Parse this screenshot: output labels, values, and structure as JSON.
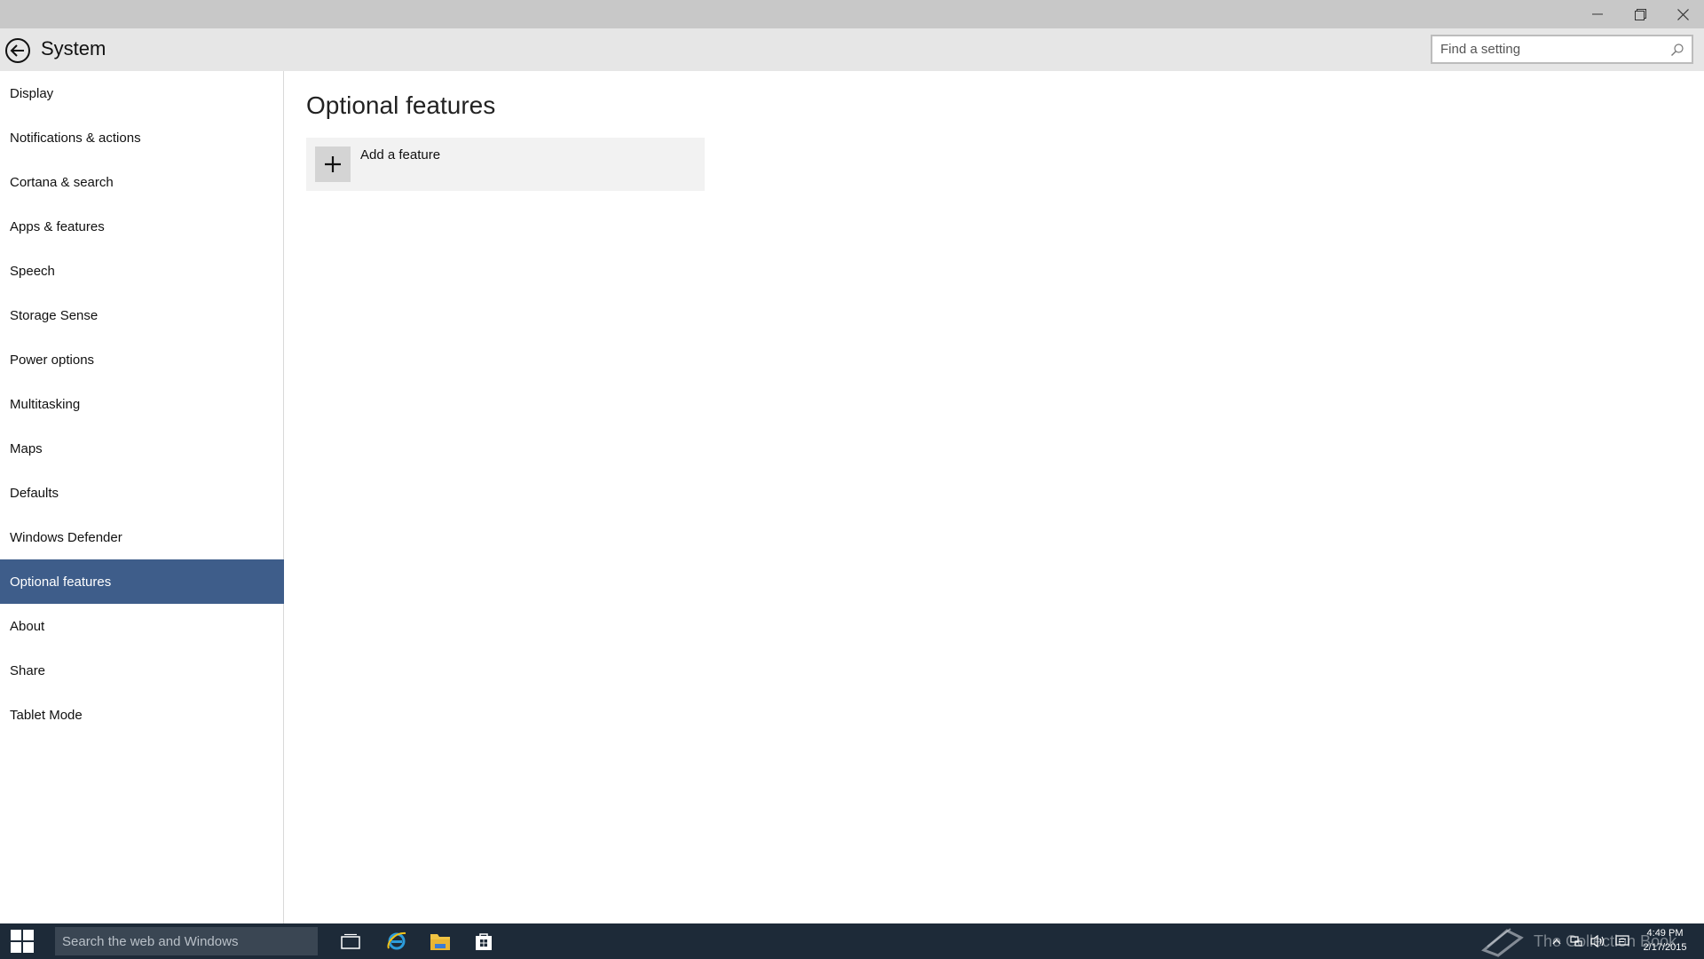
{
  "window": {
    "controls": {
      "minimize": "minimize-icon",
      "maximize": "restore-icon",
      "close": "close-icon"
    }
  },
  "header": {
    "title": "System",
    "back_icon": "back-arrow-icon",
    "search": {
      "placeholder": "Find a setting",
      "value": "",
      "icon": "search-icon"
    }
  },
  "sidebar": {
    "items": [
      {
        "label": "Display",
        "selected": false
      },
      {
        "label": "Notifications & actions",
        "selected": false
      },
      {
        "label": "Cortana & search",
        "selected": false
      },
      {
        "label": "Apps & features",
        "selected": false
      },
      {
        "label": "Speech",
        "selected": false
      },
      {
        "label": "Storage Sense",
        "selected": false
      },
      {
        "label": "Power options",
        "selected": false
      },
      {
        "label": "Multitasking",
        "selected": false
      },
      {
        "label": "Maps",
        "selected": false
      },
      {
        "label": "Defaults",
        "selected": false
      },
      {
        "label": "Windows Defender",
        "selected": false
      },
      {
        "label": "Optional features",
        "selected": true
      },
      {
        "label": "About",
        "selected": false
      },
      {
        "label": "Share",
        "selected": false
      },
      {
        "label": "Tablet Mode",
        "selected": false
      }
    ]
  },
  "main": {
    "title": "Optional features",
    "add_feature": {
      "label": "Add a feature",
      "icon": "plus-icon"
    }
  },
  "taskbar": {
    "search_placeholder": "Search the web and Windows",
    "apps": [
      "task-view-icon",
      "internet-explorer-icon",
      "file-explorer-icon",
      "store-icon"
    ],
    "watermark": "The Collection Book",
    "time": "4:49 PM",
    "date": "2/17/2015"
  },
  "colors": {
    "accent": "#3e5d8a",
    "titlebar": "#c8c8c8",
    "header": "#e6e6e6",
    "taskbar": "#1d2a38"
  }
}
